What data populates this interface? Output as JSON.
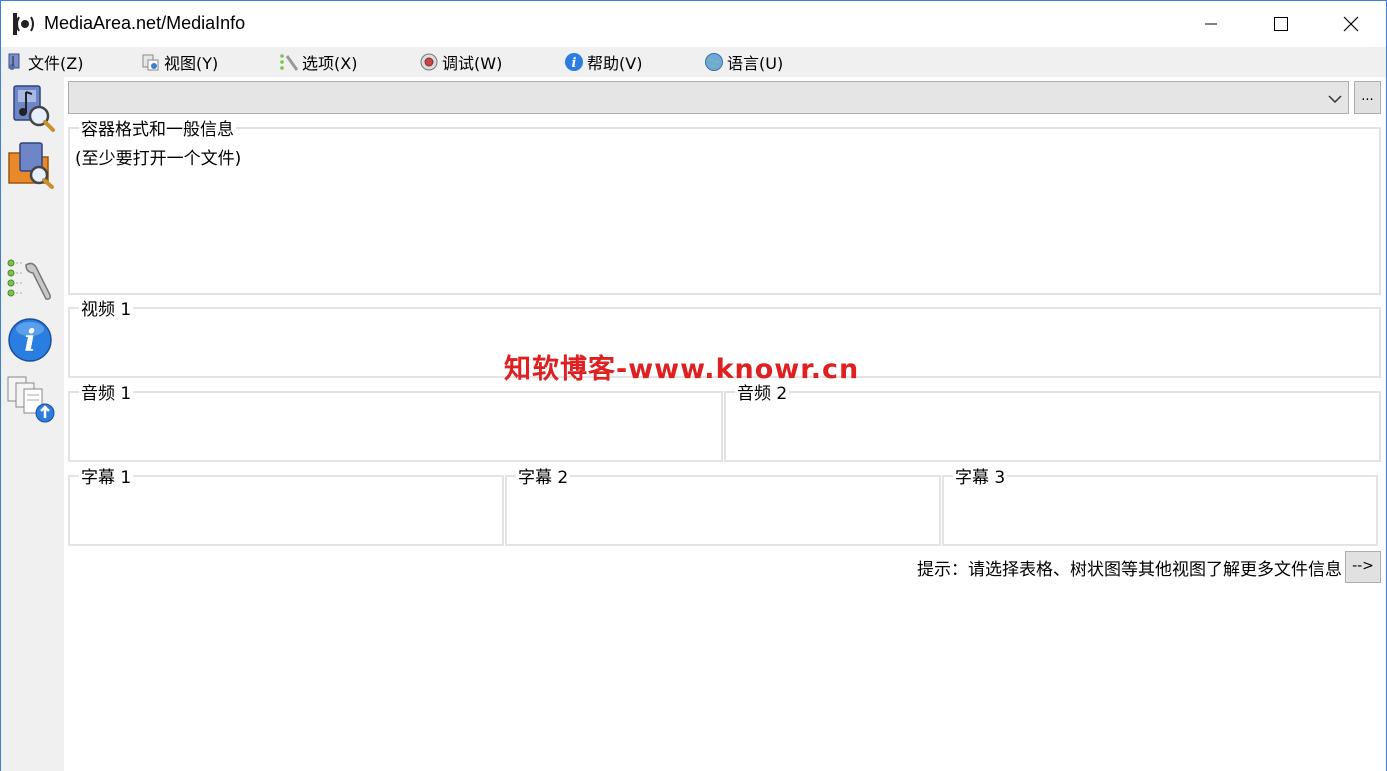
{
  "window": {
    "title": "MediaArea.net/MediaInfo"
  },
  "menu": {
    "items": [
      {
        "label": "文件(Z)",
        "icon": "file-open-icon"
      },
      {
        "label": "视图(Y)",
        "icon": "view-icon"
      },
      {
        "label": "选项(X)",
        "icon": "options-icon"
      },
      {
        "label": "调试(W)",
        "icon": "debug-icon"
      },
      {
        "label": "帮助(V)",
        "icon": "help-icon"
      },
      {
        "label": "语言(U)",
        "icon": "language-globe-icon"
      }
    ]
  },
  "toolbar": {
    "buttons": [
      {
        "icon": "open-file-icon"
      },
      {
        "icon": "open-folder-icon"
      },
      {
        "icon": "preferences-icon"
      },
      {
        "icon": "about-info-icon"
      },
      {
        "icon": "export-icon"
      }
    ]
  },
  "file_selector": {
    "value": "",
    "browse_label": "..."
  },
  "sections": {
    "general": {
      "label": "容器格式和一般信息",
      "text": "(至少要打开一个文件)"
    },
    "video1": {
      "label": "视频 1"
    },
    "audio1": {
      "label": "音频 1"
    },
    "audio2": {
      "label": "音频 2"
    },
    "sub1": {
      "label": "字幕 1"
    },
    "sub2": {
      "label": "字幕 2"
    },
    "sub3": {
      "label": "字幕 3"
    }
  },
  "hint": {
    "text": "提示：请选择表格、树状图等其他视图了解更多文件信息",
    "button_label": "-->"
  },
  "watermark": {
    "text": "知软博客-www.knowr.cn"
  },
  "colors": {
    "window_border": "#3a7fd4",
    "panel_bg": "#f0f0f0",
    "watermark": "#e02020"
  }
}
